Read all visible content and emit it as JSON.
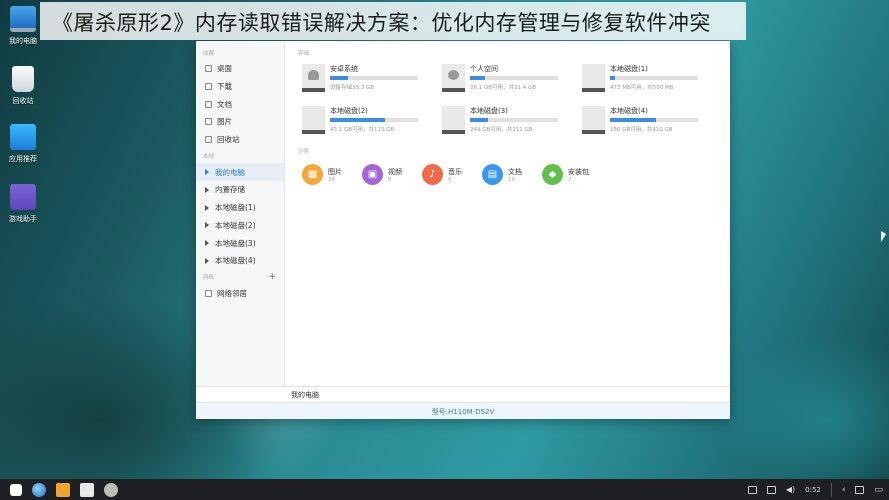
{
  "banner": {
    "text": "《屠杀原形2》内存读取错误解决方案：优化内存管理与修复软件冲突"
  },
  "desktop": {
    "icons": [
      {
        "label": "我的电脑",
        "icon": "computer-icon"
      },
      {
        "label": "回收站",
        "icon": "trash-icon"
      },
      {
        "label": "应用推荐",
        "icon": "app-store-icon"
      },
      {
        "label": "游戏助手",
        "icon": "game-assistant-icon"
      }
    ]
  },
  "sidebar": {
    "favorites_label": "收藏",
    "favorites": [
      {
        "label": "桌面",
        "icon": "desktop-folder-icon"
      },
      {
        "label": "下载",
        "icon": "download-icon"
      },
      {
        "label": "文档",
        "icon": "document-icon"
      },
      {
        "label": "图片",
        "icon": "picture-icon"
      },
      {
        "label": "回收站",
        "icon": "trash-icon"
      }
    ],
    "local_label": "本地",
    "local": [
      {
        "label": "我的电脑",
        "active": true
      },
      {
        "label": "内置存储"
      },
      {
        "label": "本地磁盘(1)"
      },
      {
        "label": "本地磁盘(2)"
      },
      {
        "label": "本地磁盘(3)"
      },
      {
        "label": "本地磁盘(4)"
      }
    ],
    "network_label": "网络",
    "network_add": "+",
    "network": [
      {
        "label": "网络邻居",
        "icon": "network-icon"
      }
    ]
  },
  "content": {
    "storage_label": "存储",
    "disks": [
      {
        "name": "安卓系统",
        "capacity": "设备存储33.3 GB",
        "used": 0.2,
        "icon": "android-icon"
      },
      {
        "name": "个人空间",
        "capacity": "26.1 GB可用，共31.4 GB",
        "used": 0.17,
        "icon": "user-icon"
      },
      {
        "name": "本地磁盘(1)",
        "capacity": "472 MB可用，共500 MB",
        "used": 0.06
      },
      {
        "name": "本地磁盘(2)",
        "capacity": "43.1 GB可用，共115 GB",
        "used": 0.63
      },
      {
        "name": "本地磁盘(3)",
        "capacity": "249 GB可用，共311 GB",
        "used": 0.2
      },
      {
        "name": "本地磁盘(4)",
        "capacity": "150 GB可用，共310 GB",
        "used": 0.52
      }
    ],
    "category_label": "分类",
    "categories": [
      {
        "name": "图片",
        "count": "34",
        "color": "#f3a83b",
        "glyph": "▦",
        "icon": "image-category-icon"
      },
      {
        "name": "视频",
        "count": "0",
        "color": "#a565d6",
        "glyph": "▣",
        "icon": "video-category-icon"
      },
      {
        "name": "音乐",
        "count": "0",
        "color": "#ef6a4b",
        "glyph": "♪",
        "icon": "music-category-icon"
      },
      {
        "name": "文档",
        "count": "10",
        "color": "#3a97ee",
        "glyph": "▤",
        "icon": "document-category-icon"
      },
      {
        "name": "安装包",
        "count": "7",
        "color": "#5fc04a",
        "glyph": "◆",
        "icon": "package-category-icon"
      }
    ]
  },
  "statusbar": {
    "text": "我的电脑"
  },
  "footer": {
    "text": "型号:H110M-DS2V"
  },
  "taskbar": {
    "time": "0:52"
  }
}
